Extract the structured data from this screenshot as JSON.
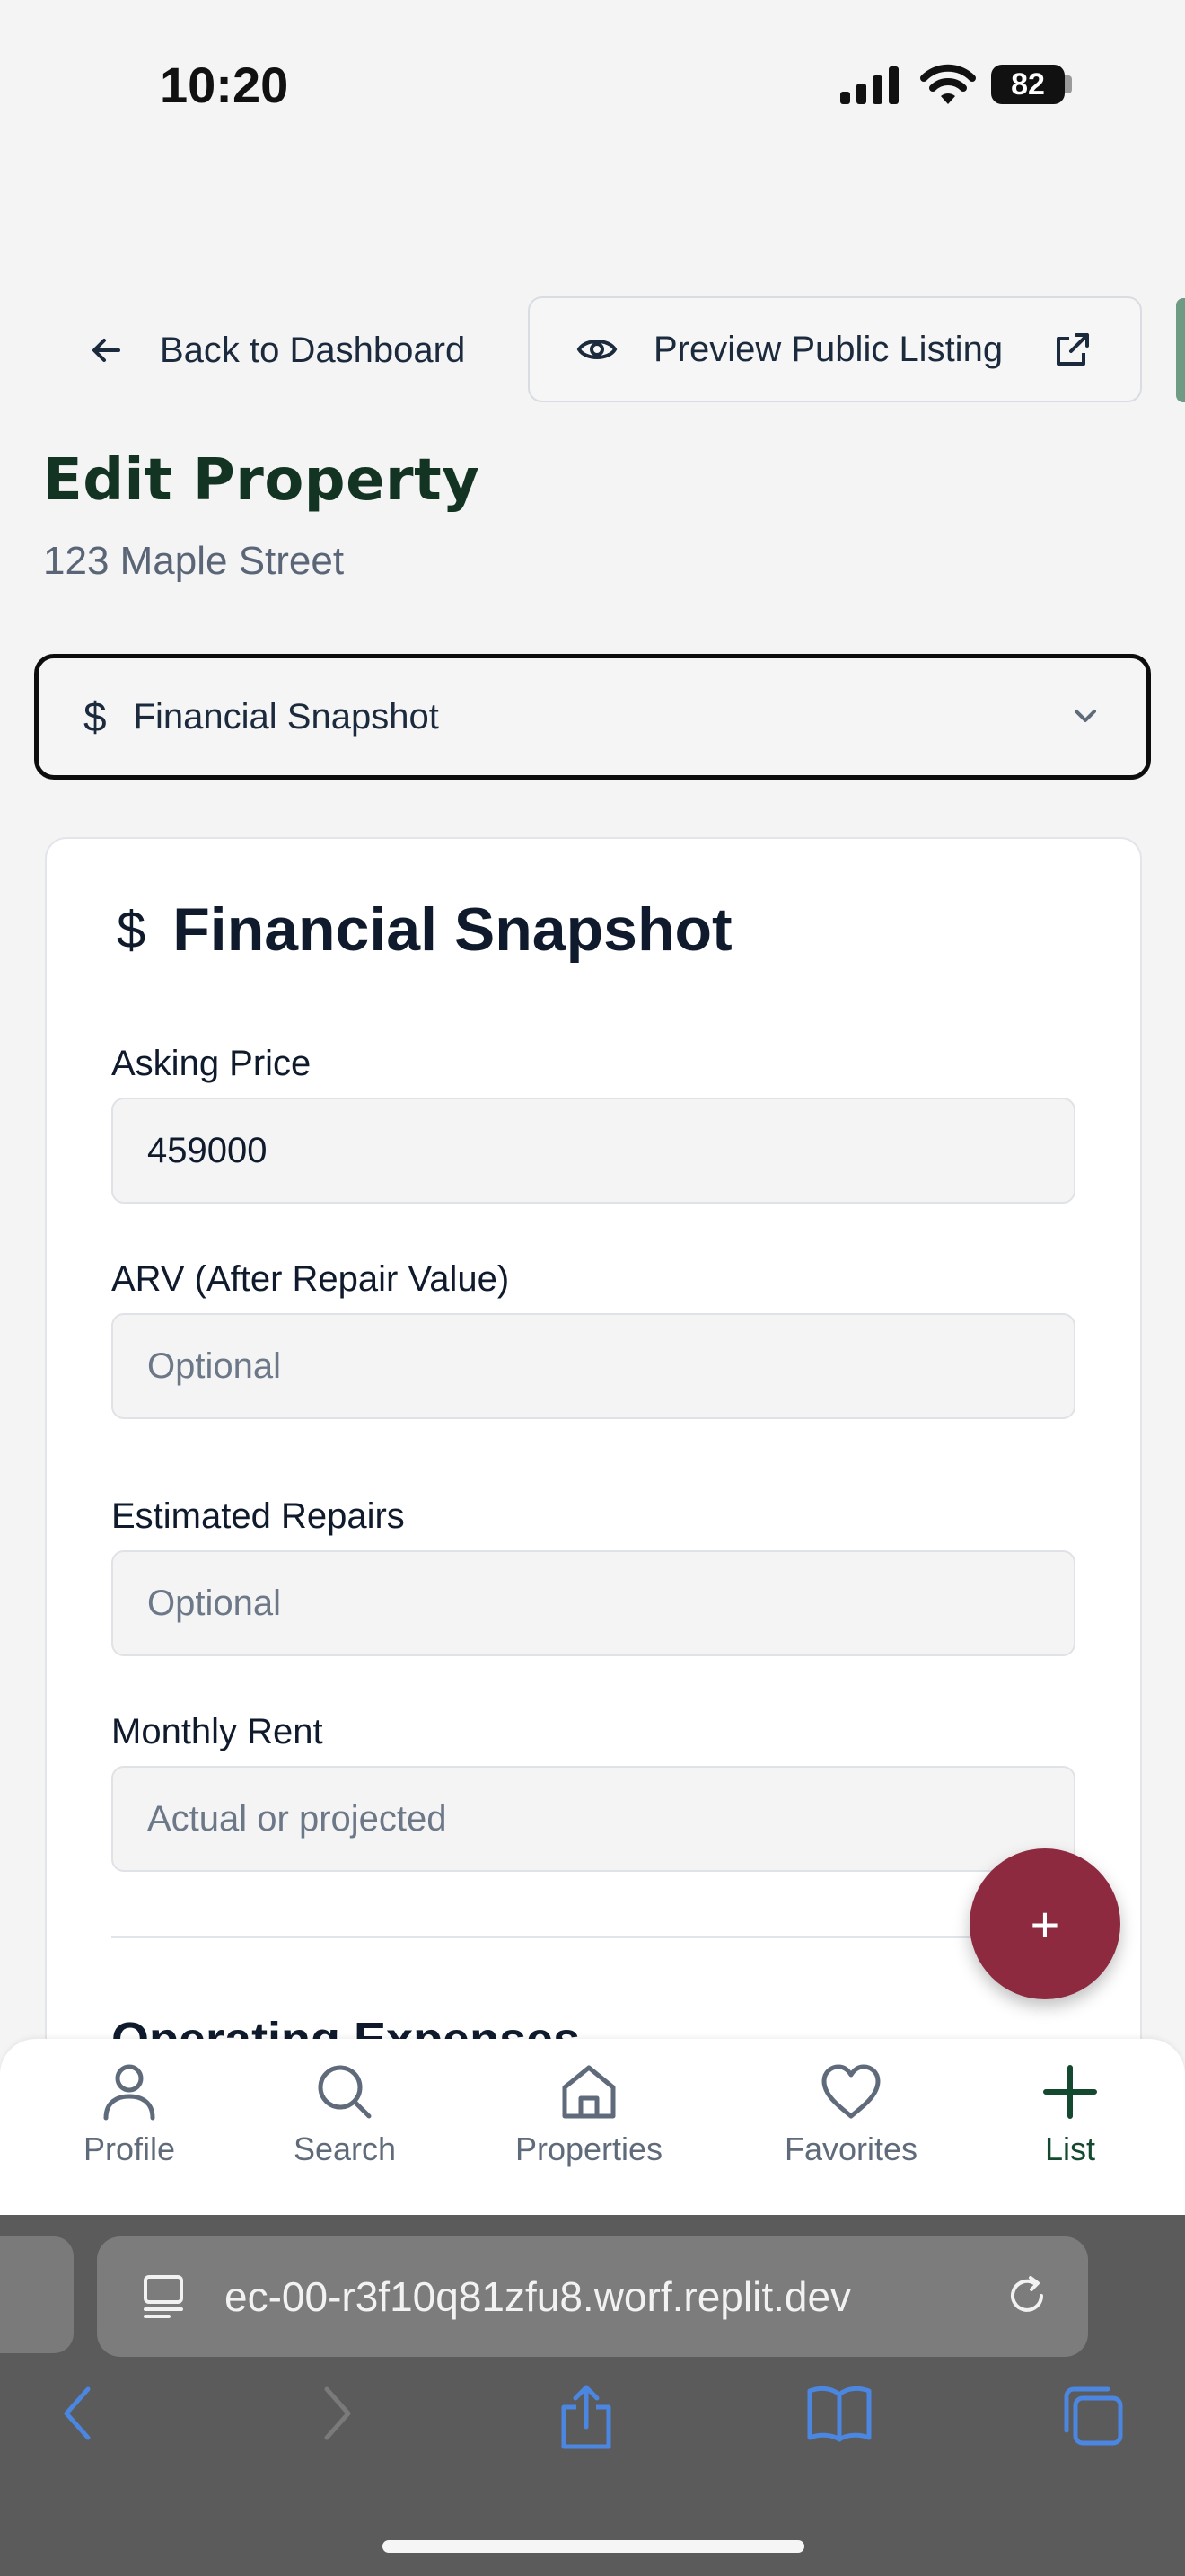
{
  "status_bar": {
    "time": "10:20",
    "battery": "82"
  },
  "header": {
    "back_label": "Back to Dashboard",
    "preview_label": "Preview Public Listing"
  },
  "page": {
    "title": "Edit Property",
    "subtitle": "123 Maple Street"
  },
  "section_select": {
    "icon": "dollar-icon",
    "value": "Financial Snapshot"
  },
  "card": {
    "title": "Financial Snapshot",
    "fields": [
      {
        "label": "Asking Price",
        "value": "459000",
        "placeholder": ""
      },
      {
        "label": "ARV (After Repair Value)",
        "value": "",
        "placeholder": "Optional"
      },
      {
        "label": "Estimated Repairs",
        "value": "",
        "placeholder": "Optional"
      },
      {
        "label": "Monthly Rent",
        "value": "",
        "placeholder": "Actual or projected"
      }
    ],
    "next_section": "Operating Expenses"
  },
  "fab": {
    "label": "+"
  },
  "bottom_nav": {
    "items": [
      {
        "label": "Profile",
        "icon": "person-icon"
      },
      {
        "label": "Search",
        "icon": "search-icon"
      },
      {
        "label": "Properties",
        "icon": "home-icon"
      },
      {
        "label": "Favorites",
        "icon": "heart-icon"
      },
      {
        "label": "List",
        "icon": "plus-icon"
      }
    ],
    "active": "List",
    "active_color": "#14482f",
    "fab_color": "#8e2a3f"
  },
  "browser": {
    "url": "ec-00-r3f10q81zfu8.worf.replit.dev"
  }
}
